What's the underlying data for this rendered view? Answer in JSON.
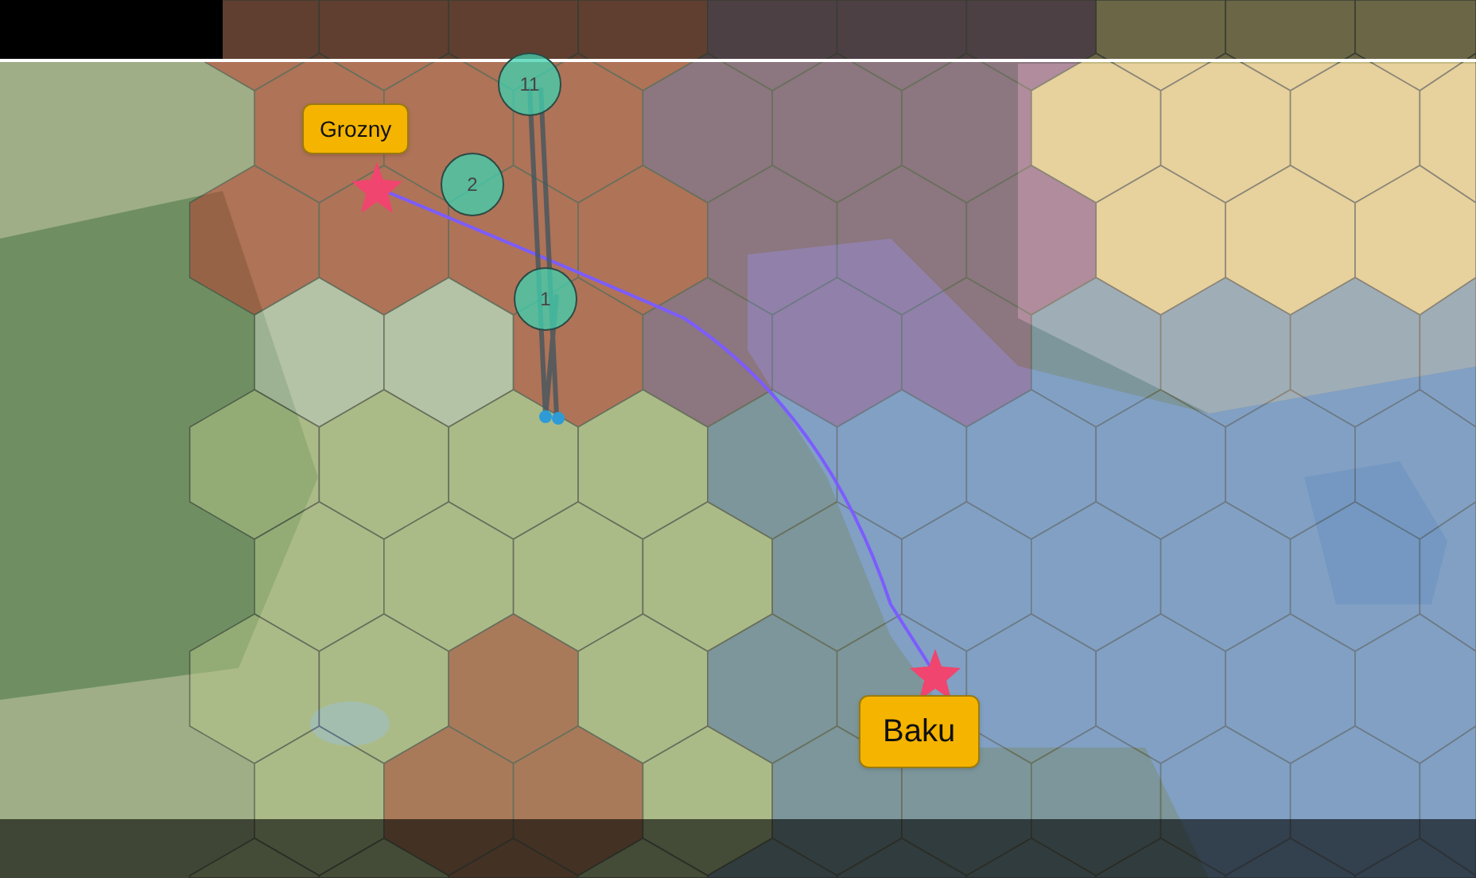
{
  "markers": [
    {
      "label": "Grozny"
    },
    {
      "label": "Baku"
    }
  ],
  "clusters": [
    {
      "count": "11"
    },
    {
      "count": "2"
    },
    {
      "count": "1"
    }
  ]
}
